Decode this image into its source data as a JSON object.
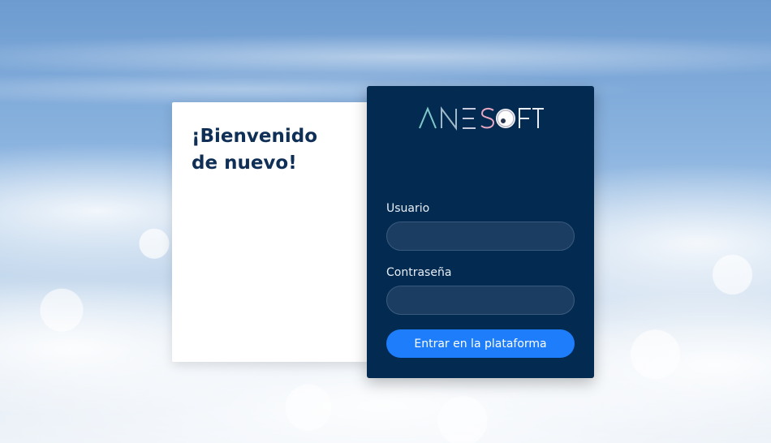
{
  "welcome": {
    "title": "¡Bienvenido de nuevo!"
  },
  "logo": {
    "text": "ANESOFT",
    "colors": {
      "teal": "#7fc8c9",
      "pink": "#e7a7c3",
      "white": "#e9eef6"
    }
  },
  "login": {
    "username_label": "Usuario",
    "username_value": "",
    "password_label": "Contraseña",
    "password_value": "",
    "submit_label": "Entrar en la plataforma"
  },
  "colors": {
    "panel": "#032b51",
    "input_bg": "#1c3d62",
    "button": "#1d7dfa",
    "title": "#0f2f56"
  }
}
